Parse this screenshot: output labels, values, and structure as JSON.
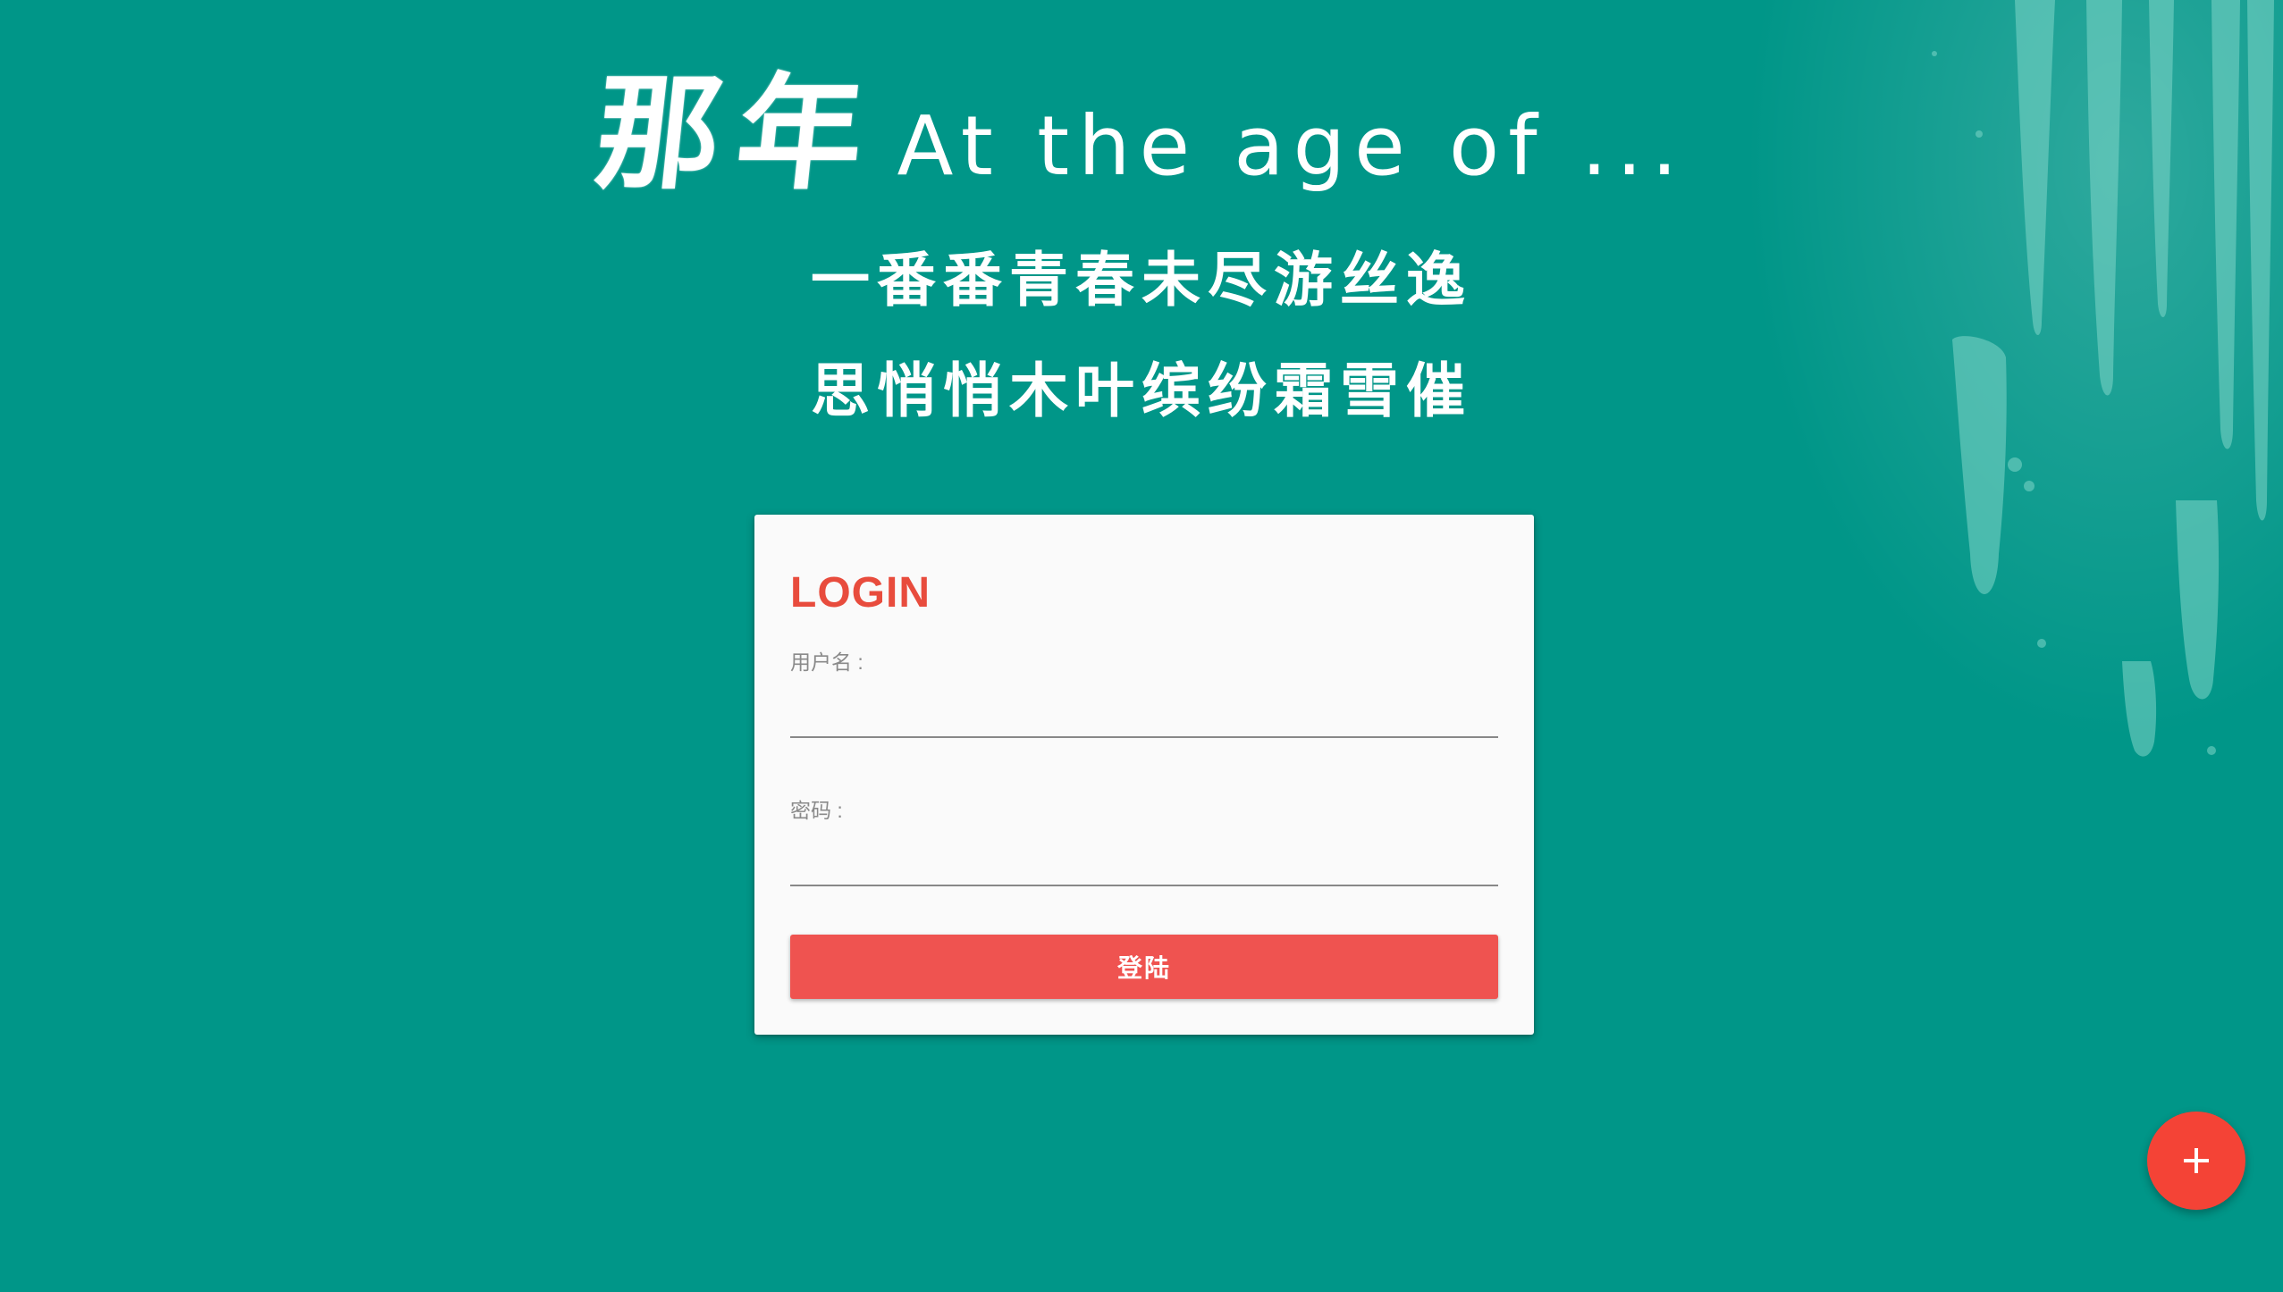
{
  "hero": {
    "title_cn": "那年",
    "title_en": "At the age of ...",
    "line1": "一番番青春未尽游丝逸",
    "line2": "思悄悄木叶缤纷霜雪催"
  },
  "login": {
    "title": "LOGIN",
    "username_label": "用户名 :",
    "username_value": "",
    "password_label": "密码 :",
    "password_value": "",
    "submit_label": "登陆"
  },
  "fab": {
    "icon": "plus-icon"
  },
  "colors": {
    "background": "#009688",
    "accent": "#e84c3d",
    "button": "#ef5350",
    "fab": "#f44336",
    "card": "#fafafa"
  }
}
